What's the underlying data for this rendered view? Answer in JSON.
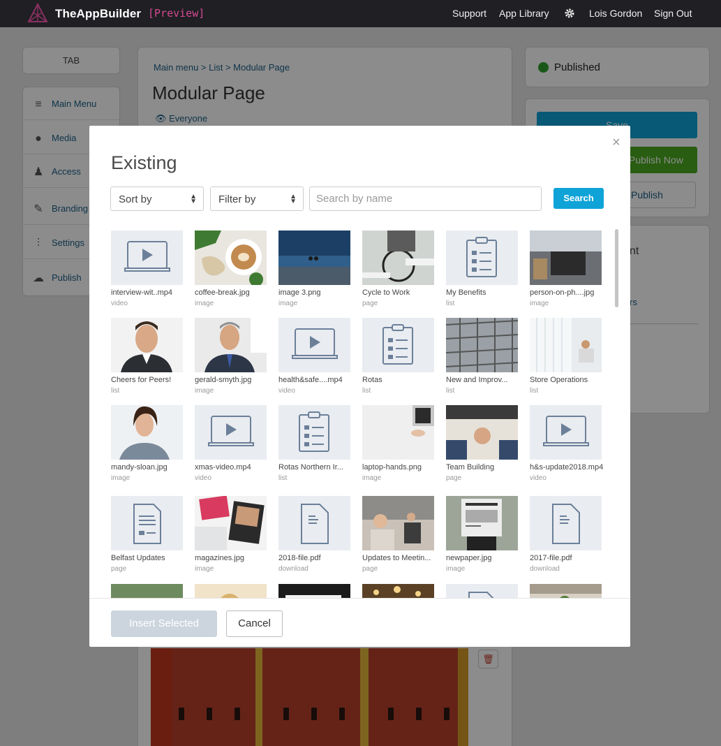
{
  "topbar": {
    "brand": "TheAppBuilder",
    "preview": "[Preview]",
    "nav": [
      "Support",
      "App Library",
      "Lois Gordon",
      "Sign Out"
    ]
  },
  "page": {
    "tab_label": "TAB",
    "sidebar": [
      {
        "label": "Main Menu",
        "icon": "menu-icon"
      },
      {
        "label": "Media",
        "icon": "play-circle-icon"
      },
      {
        "label": "Access",
        "icon": "user-icon"
      },
      {
        "label": "Branding",
        "icon": "brush-icon"
      },
      {
        "label": "Settings",
        "icon": "sliders-icon"
      },
      {
        "label": "Publish",
        "icon": "cloud-upload-icon"
      }
    ],
    "breadcrumb": "Main menu > List > Modular Page",
    "title": "Modular Page",
    "audience": "Everyone",
    "status": "Published",
    "save_label": "Save",
    "publish_now_label": "Publish Now",
    "unpublish_label": "Publish",
    "side_text_a": "nt",
    "side_text_b": "rs"
  },
  "modal": {
    "title": "Existing",
    "close": "×",
    "sort_label": "Sort by",
    "filter_label": "Filter by",
    "search_placeholder": "Search by name",
    "search_button": "Search",
    "insert_button": "Insert Selected",
    "cancel_button": "Cancel",
    "items": [
      {
        "name": "interview-wit..mp4",
        "type": "video",
        "thumb": "video"
      },
      {
        "name": "coffee-break.jpg",
        "type": "image",
        "thumb": "coffee"
      },
      {
        "name": "image 3.png",
        "type": "image",
        "thumb": "beach"
      },
      {
        "name": "Cycle to Work",
        "type": "page",
        "thumb": "cycle"
      },
      {
        "name": "My Benefits",
        "type": "list",
        "thumb": "list"
      },
      {
        "name": "person-on-ph....jpg",
        "type": "image",
        "thumb": "office"
      },
      {
        "name": "Cheers for Peers!",
        "type": "list",
        "thumb": "man1"
      },
      {
        "name": "gerald-smyth.jpg",
        "type": "image",
        "thumb": "man2"
      },
      {
        "name": "health&safe....mp4",
        "type": "video",
        "thumb": "video"
      },
      {
        "name": "Rotas",
        "type": "list",
        "thumb": "list"
      },
      {
        "name": "New and Improv...",
        "type": "list",
        "thumb": "building"
      },
      {
        "name": "Store Operations",
        "type": "list",
        "thumb": "window"
      },
      {
        "name": "mandy-sloan.jpg",
        "type": "image",
        "thumb": "woman"
      },
      {
        "name": "xmas-video.mp4",
        "type": "video",
        "thumb": "video"
      },
      {
        "name": "Rotas Northern Ir...",
        "type": "list",
        "thumb": "list"
      },
      {
        "name": "laptop-hands.png",
        "type": "image",
        "thumb": "laptop"
      },
      {
        "name": "Team Building",
        "type": "page",
        "thumb": "team"
      },
      {
        "name": "h&s-update2018.mp4",
        "type": "video",
        "thumb": "video"
      },
      {
        "name": "Belfast Updates",
        "type": "page",
        "thumb": "page"
      },
      {
        "name": "magazines.jpg",
        "type": "image",
        "thumb": "magazine"
      },
      {
        "name": "2018-file.pdf",
        "type": "download",
        "thumb": "file"
      },
      {
        "name": "Updates to Meetin...",
        "type": "page",
        "thumb": "meeting"
      },
      {
        "name": "newpaper.jpg",
        "type": "image",
        "thumb": "newspaper"
      },
      {
        "name": "2017-file.pdf",
        "type": "download",
        "thumb": "file"
      },
      {
        "name": "",
        "type": "",
        "thumb": "street"
      },
      {
        "name": "",
        "type": "",
        "thumb": "blonde"
      },
      {
        "name": "",
        "type": "",
        "thumb": "dark"
      },
      {
        "name": "",
        "type": "",
        "thumb": "bokeh"
      },
      {
        "name": "",
        "type": "",
        "thumb": "file"
      },
      {
        "name": "",
        "type": "",
        "thumb": "plant"
      }
    ]
  },
  "colors": {
    "topbar": "#1f1f24",
    "accent_blue": "#0fa3d8",
    "publish_green": "#4caa1f",
    "preview_pink": "#d64a8f",
    "link": "#1b5f86"
  }
}
